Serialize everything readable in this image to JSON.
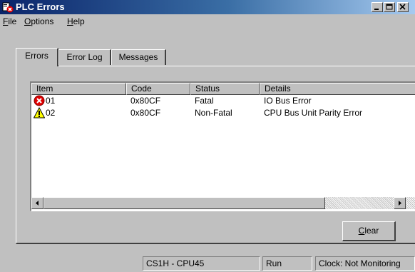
{
  "window": {
    "title": "PLC Errors"
  },
  "menu": [
    {
      "label": "File",
      "mnemonic": "F",
      "rest": "ile"
    },
    {
      "label": "Options",
      "mnemonic": "O",
      "rest": "ptions"
    },
    {
      "label": "Help",
      "mnemonic": "H",
      "rest": "elp"
    }
  ],
  "tabs": [
    {
      "label": "Errors",
      "active": true
    },
    {
      "label": "Error Log",
      "active": false
    },
    {
      "label": "Messages",
      "active": false
    }
  ],
  "list": {
    "columns": [
      "Item",
      "Code",
      "Status",
      "Details"
    ],
    "rows": [
      {
        "icon": "error-icon",
        "item": "01",
        "code": "0x80CF",
        "status": "Fatal",
        "details": "IO Bus Error"
      },
      {
        "icon": "warning-icon",
        "item": "02",
        "code": "0x80CF",
        "status": "Non-Fatal",
        "details": "CPU Bus Unit Parity Error"
      }
    ]
  },
  "buttons": {
    "clear": "Clear",
    "clear_mnemonic": "C",
    "clear_rest": "lear"
  },
  "statusbar": {
    "device": "CS1H - CPU45",
    "mode": "Run",
    "clock": "Clock: Not Monitoring"
  },
  "colors": {
    "titlebar_start": "#0a246a",
    "titlebar_end": "#a6caf0",
    "error": "#e00000",
    "warning": "#ffff00"
  }
}
